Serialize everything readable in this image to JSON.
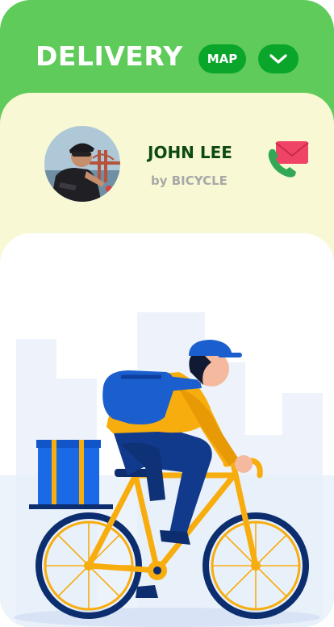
{
  "header": {
    "title": "DELIVERY",
    "map_label": "MAP",
    "dropdown_icon": "chevron-down-icon"
  },
  "courier": {
    "name": "JOHN LEE",
    "method": "by BICYCLE",
    "avatar": "courier-avatar",
    "contact_icons": [
      "phone-icon",
      "mail-icon"
    ]
  },
  "illustration": "delivery-cyclist-illustration",
  "colors": {
    "header_green": "#5fcb5a",
    "button_green": "#0aa52b",
    "card_yellow": "#f8f8d4",
    "name_green": "#0c4a12",
    "bike_yellow": "#f7ad0e",
    "courier_blue": "#123a8c"
  }
}
